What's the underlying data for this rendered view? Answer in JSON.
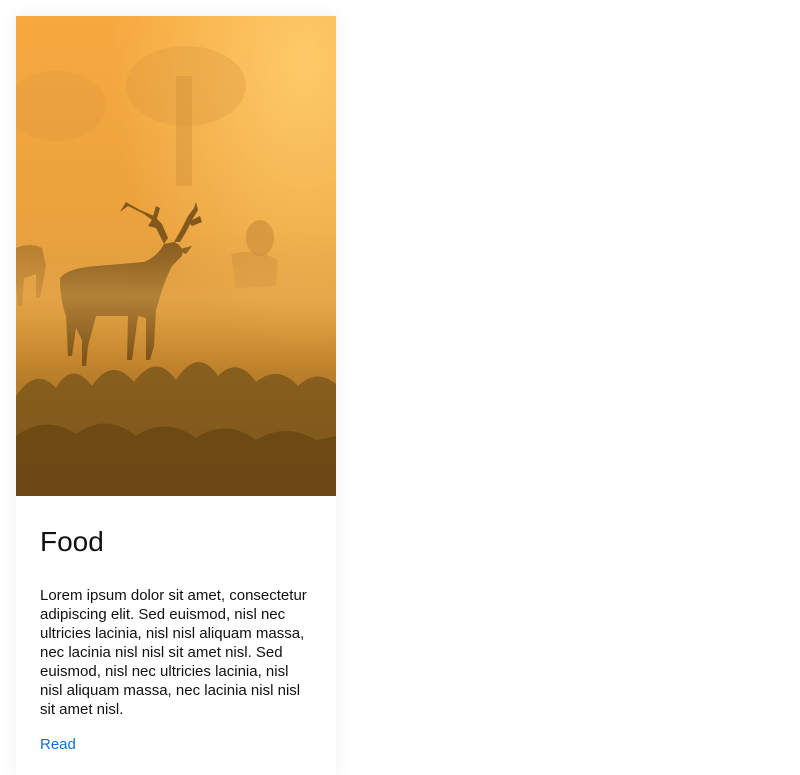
{
  "card": {
    "image": {
      "subject": "deer-in-foggy-sunrise",
      "colors": {
        "sky_top": "#f9b24a",
        "sky_mid": "#e9a13c",
        "ground": "#7a5518",
        "silhouette": "#6b4a16"
      }
    },
    "title": "Food",
    "text": "Lorem ipsum dolor sit amet, consectetur adipiscing elit. Sed euismod, nisl nec ultricies lacinia, nisl nisl aliquam massa, nec lacinia nisl nisl sit amet nisl. Sed euismod, nisl nec ultricies lacinia, nisl nisl aliquam massa, nec lacinia nisl nisl sit amet nisl.",
    "link_label": "Read",
    "link_color": "#0a73d6"
  }
}
